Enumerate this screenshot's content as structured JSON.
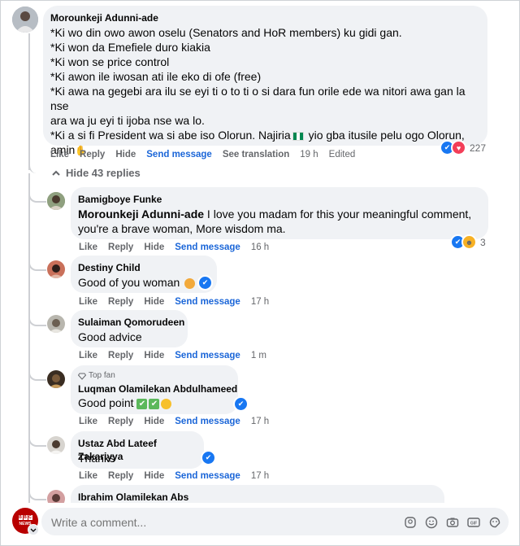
{
  "main_comment": {
    "author": "Morounkeji Adunni-ade",
    "lines": [
      "*Ki wo din owo awon oselu (Senators and HoR members) ku gidi gan.",
      "*Ki won da Emefiele duro kiakia",
      "*Ki won se price control",
      "*Ki awon ile iwosan ati ile eko di ofe (free)",
      "*Ki awa na gegebi ara ilu se eyi ti o to ti o si dara fun orile ede wa nitori awa gan la nse",
      "ara wa ju eyi ti ijoba nse wa lo.",
      "*Ki a si fi President wa si abe iso Olorun. Najiria",
      " yio gba itusile pelu ogo Olorun,",
      "amin"
    ],
    "actions": {
      "like": "Like",
      "reply": "Reply",
      "hide": "Hide",
      "send": "Send message",
      "translate": "See translation",
      "time": "19 h",
      "edited": "Edited"
    },
    "reaction_count": "227"
  },
  "hide_replies": "Hide 43 replies",
  "replies": [
    {
      "author": "Bamigboye Funke",
      "mention": "Morounkeji Adunni-ade",
      "text": " I love you madam for this your meaningful comment, you're a brave woman, More wisdom ma.",
      "time": "16 h",
      "reaction_count": "3"
    },
    {
      "author": "Destiny Child",
      "text": "Good of you woman",
      "time": "17 h"
    },
    {
      "author": "Sulaiman Qomorudeen",
      "text": "Good advice",
      "time": "1 m"
    },
    {
      "badge": "Top fan",
      "author": "Luqman Olamilekan Abdulhameed",
      "text": "Good point",
      "time": "17 h"
    },
    {
      "author": "Ustaz Abd Lateef Zakariyya",
      "text": "Thanks",
      "time": "17 h"
    },
    {
      "author": "Ibrahim Olamilekan Abs"
    }
  ],
  "reply_actions": {
    "like": "Like",
    "reply": "Reply",
    "hide": "Hide",
    "send": "Send message"
  },
  "composer": {
    "placeholder": "Write a comment...",
    "avatar_label": "BBC NEWS"
  },
  "colors": {
    "accent": "#1b66d8",
    "bubble": "#f0f2f5",
    "muted": "#65676b",
    "like": "#1877f2",
    "love": "#f33e58",
    "bbc": "#b80000"
  }
}
